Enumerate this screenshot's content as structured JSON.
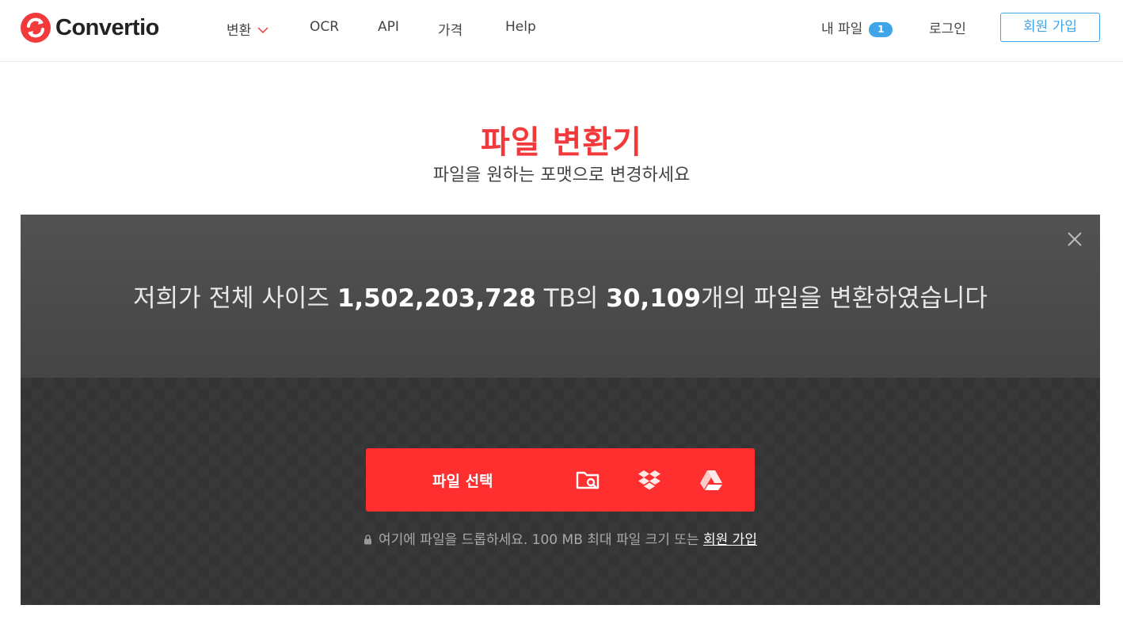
{
  "header": {
    "logo_text": "Convertio",
    "nav": [
      {
        "label": "변환"
      },
      {
        "label": "OCR"
      },
      {
        "label": "API"
      },
      {
        "label": "가격"
      },
      {
        "label": "Help"
      }
    ],
    "my_files_label": "내 파일",
    "my_files_count": "1",
    "login_label": "로그인",
    "signup_label": "회원 가입"
  },
  "hero": {
    "title": "파일 변환기",
    "subtitle": "파일을 원하는 포맷으로 변경하세요"
  },
  "panel": {
    "stats_prefix": "저희가 전체 사이즈 ",
    "stats_size": "1,502,203,728",
    "stats_mid": " TB의 ",
    "stats_count": "30,109",
    "stats_suffix": "개의 파일을 변환하였습니다",
    "select_label": "파일 선택",
    "drop_hint": "여기에 파일을 드롭하세요. 100 MB 최대 파일 크기 또는 ",
    "drop_hint_link": "회원 가입"
  },
  "colors": {
    "brand_red": "#f23a3c",
    "button_red": "#ff2f2f",
    "accent_blue": "#3fa5e8"
  }
}
